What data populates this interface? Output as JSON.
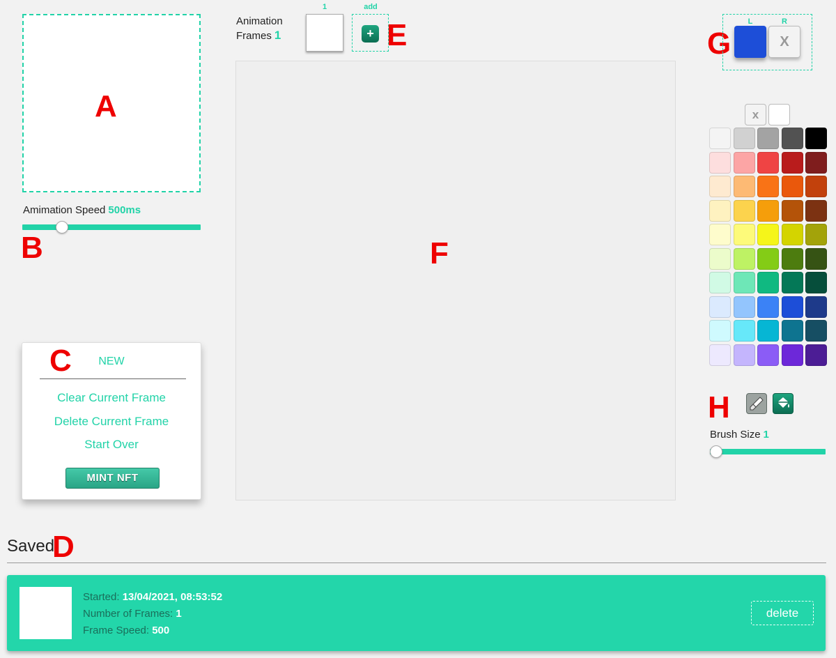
{
  "markers": {
    "a": "A",
    "b": "B",
    "c": "C",
    "d": "D",
    "e": "E",
    "f": "F",
    "g": "G",
    "h": "H"
  },
  "speed": {
    "label": "Amimation Speed",
    "value": "500ms",
    "level": 0.2
  },
  "menu": {
    "new_label": "NEW",
    "clear_label": "Clear Current Frame",
    "delete_label": "Delete Current Frame",
    "start_over_label": "Start Over",
    "mint_label": "MINT NFT"
  },
  "frames": {
    "label_line1": "Animation",
    "label_line2": "Frames",
    "count": "1",
    "thumb_index": "1",
    "add_label": "add",
    "add_icon": "+"
  },
  "color_select": {
    "left_label": "L",
    "right_label": "R",
    "left_color": "#1d4ed8",
    "right_symbol": "X"
  },
  "palette": {
    "clear_symbol": "x",
    "rows": [
      [
        "#f4f4f4",
        "#d1d1d1",
        "#a3a3a3",
        "#525252",
        "#000000"
      ],
      [
        "#fddede",
        "#fca5a5",
        "#ef4444",
        "#b91c1c",
        "#7f1d1d"
      ],
      [
        "#feead0",
        "#fdba74",
        "#f97316",
        "#ea580c",
        "#c2410c"
      ],
      [
        "#fef2c0",
        "#fcd34d",
        "#f59e0b",
        "#b45309",
        "#7c3212"
      ],
      [
        "#fefccc",
        "#fdfa7a",
        "#f5f51a",
        "#d4d400",
        "#a3a30a"
      ],
      [
        "#ecfccb",
        "#bef264",
        "#84cc16",
        "#4d7c0f",
        "#365314"
      ],
      [
        "#d1fae5",
        "#6ee7b7",
        "#10b981",
        "#047857",
        "#064e3b"
      ],
      [
        "#dbeafe",
        "#93c5fd",
        "#3b82f6",
        "#1d4ed8",
        "#1e3a8a"
      ],
      [
        "#cffafe",
        "#67e8f9",
        "#06b6d4",
        "#0e7490",
        "#164e63"
      ],
      [
        "#ede9fe",
        "#c4b5fd",
        "#8b5cf6",
        "#6d28d9",
        "#4c1d95"
      ],
      [
        "#fce7f3",
        "#f9a8d4",
        "#ec4899",
        "#be185d",
        "#831843"
      ]
    ]
  },
  "tools": {
    "brush_icon": "brush-icon",
    "fill_icon": "paint-bucket-icon"
  },
  "brush": {
    "label": "Brush Size",
    "value": "1",
    "level": 0.0
  },
  "saved": {
    "title": "Saved",
    "items": [
      {
        "started_label": "Started:",
        "started_value": "13/04/2021, 08:53:52",
        "frames_label": "Number of Frames:",
        "frames_value": "1",
        "speed_label": "Frame Speed:",
        "speed_value": "500",
        "delete_label": "delete"
      }
    ]
  }
}
